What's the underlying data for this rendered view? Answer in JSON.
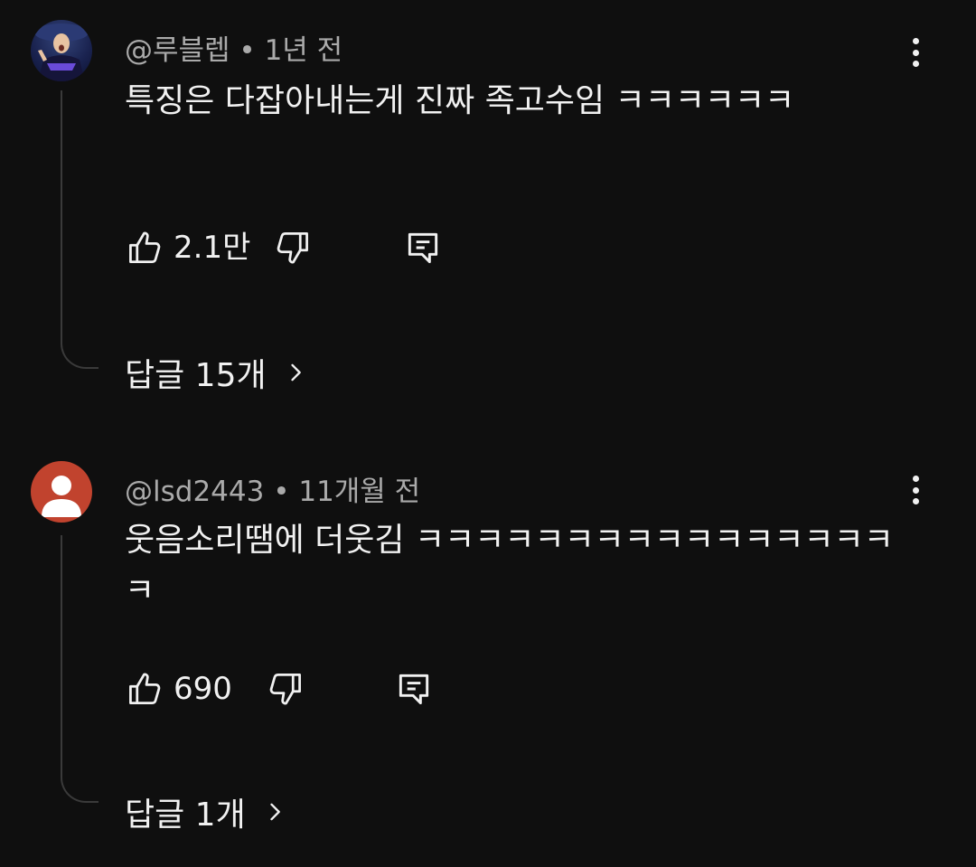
{
  "comments": [
    {
      "author": "@루블렙",
      "time": "1년 전",
      "text": "특징은 다잡아내는게 진짜 족고수임 ㅋㅋㅋㅋㅋㅋ",
      "likes": "2.1만",
      "replies": "답글 15개",
      "avatar": "profile-photo"
    },
    {
      "author": "@lsd2443",
      "time": "11개월 전",
      "text": "웃음소리땜에 더웃김 ㅋㅋㅋㅋㅋㅋㅋㅋㅋㅋㅋㅋㅋㅋㅋㅋㅋ",
      "likes": "690",
      "replies": "답글 1개",
      "avatar": "default-avatar"
    }
  ],
  "separator": " • ",
  "colors": {
    "background": "#0f0f0f",
    "text": "#f1f1f1",
    "meta": "#aaaaaa",
    "thread_line": "#3a3a3a",
    "default_avatar": "#c1432e"
  },
  "icons": {
    "like": "thumbs-up-icon",
    "dislike": "thumbs-down-icon",
    "reply": "reply-icon",
    "more": "vertical-dots-icon",
    "expand": "chevron-right-icon"
  }
}
